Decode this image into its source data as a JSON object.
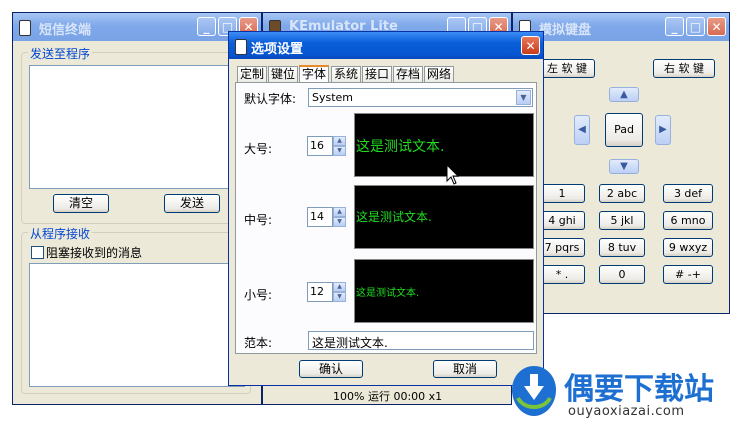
{
  "sms_window": {
    "title": "短信终端",
    "send_group": "发送至程序",
    "clear_button": "清空",
    "send_button": "发送",
    "receive_group": "从程序接收",
    "block_checkbox": "阻塞接收到的消息"
  },
  "emulator_window": {
    "title": "KEmulator Lite",
    "status": "100% 运行 00:00 x1"
  },
  "keyboard_window": {
    "title": "模拟键盘",
    "left_soft": "左 软 键",
    "right_soft": "右 软 键",
    "pad": "Pad",
    "keys": [
      "1",
      "2 abc",
      "3 def",
      "4 ghi",
      "5 jkl",
      "6 mno",
      "7 pqrs",
      "8 tuv",
      "9 wxyz",
      "* .",
      "0",
      "# -+"
    ]
  },
  "options_dialog": {
    "title": "选项设置",
    "tabs": [
      "定制",
      "键位",
      "字体",
      "系统",
      "接口",
      "存档",
      "网络"
    ],
    "active_tab": "字体",
    "default_font_label": "默认字体:",
    "default_font_value": "System",
    "large_label": "大号:",
    "large_size": "16",
    "medium_label": "中号:",
    "medium_size": "14",
    "small_label": "小号:",
    "small_size": "12",
    "preview_text": "这是测试文本.",
    "sample_label": "范本:",
    "sample_value": "这是测试文本.",
    "ok_button": "确认",
    "cancel_button": "取消"
  },
  "watermark": {
    "brand": "偶要下载站",
    "url": "ouyaoxiazai.com"
  },
  "colors": {
    "preview_text": "#22dd22",
    "active_tab_accent": "#e68b2c",
    "brand_blue": "#1d6fd1"
  }
}
